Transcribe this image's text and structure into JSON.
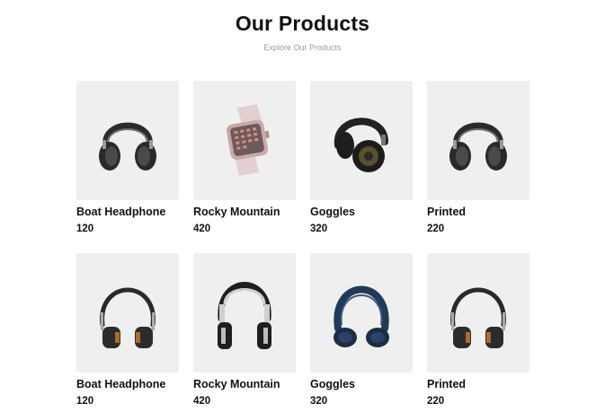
{
  "header": {
    "title": "Our Products",
    "subtitle": "Explore Our Products"
  },
  "products": [
    {
      "name": "Boat Headphone",
      "price": "120",
      "icon": "headphone-icon"
    },
    {
      "name": "Rocky Mountain",
      "price": "420",
      "icon": "smartwatch-icon"
    },
    {
      "name": "Goggles",
      "price": "320",
      "icon": "headphone-icon"
    },
    {
      "name": "Printed",
      "price": "220",
      "icon": "headphone-icon"
    },
    {
      "name": "Boat Headphone",
      "price": "120",
      "icon": "headphone-icon"
    },
    {
      "name": "Rocky Mountain",
      "price": "420",
      "icon": "headphone-icon"
    },
    {
      "name": "Goggles",
      "price": "320",
      "icon": "headphone-icon"
    },
    {
      "name": "Printed",
      "price": "220",
      "icon": "headphone-icon"
    }
  ]
}
